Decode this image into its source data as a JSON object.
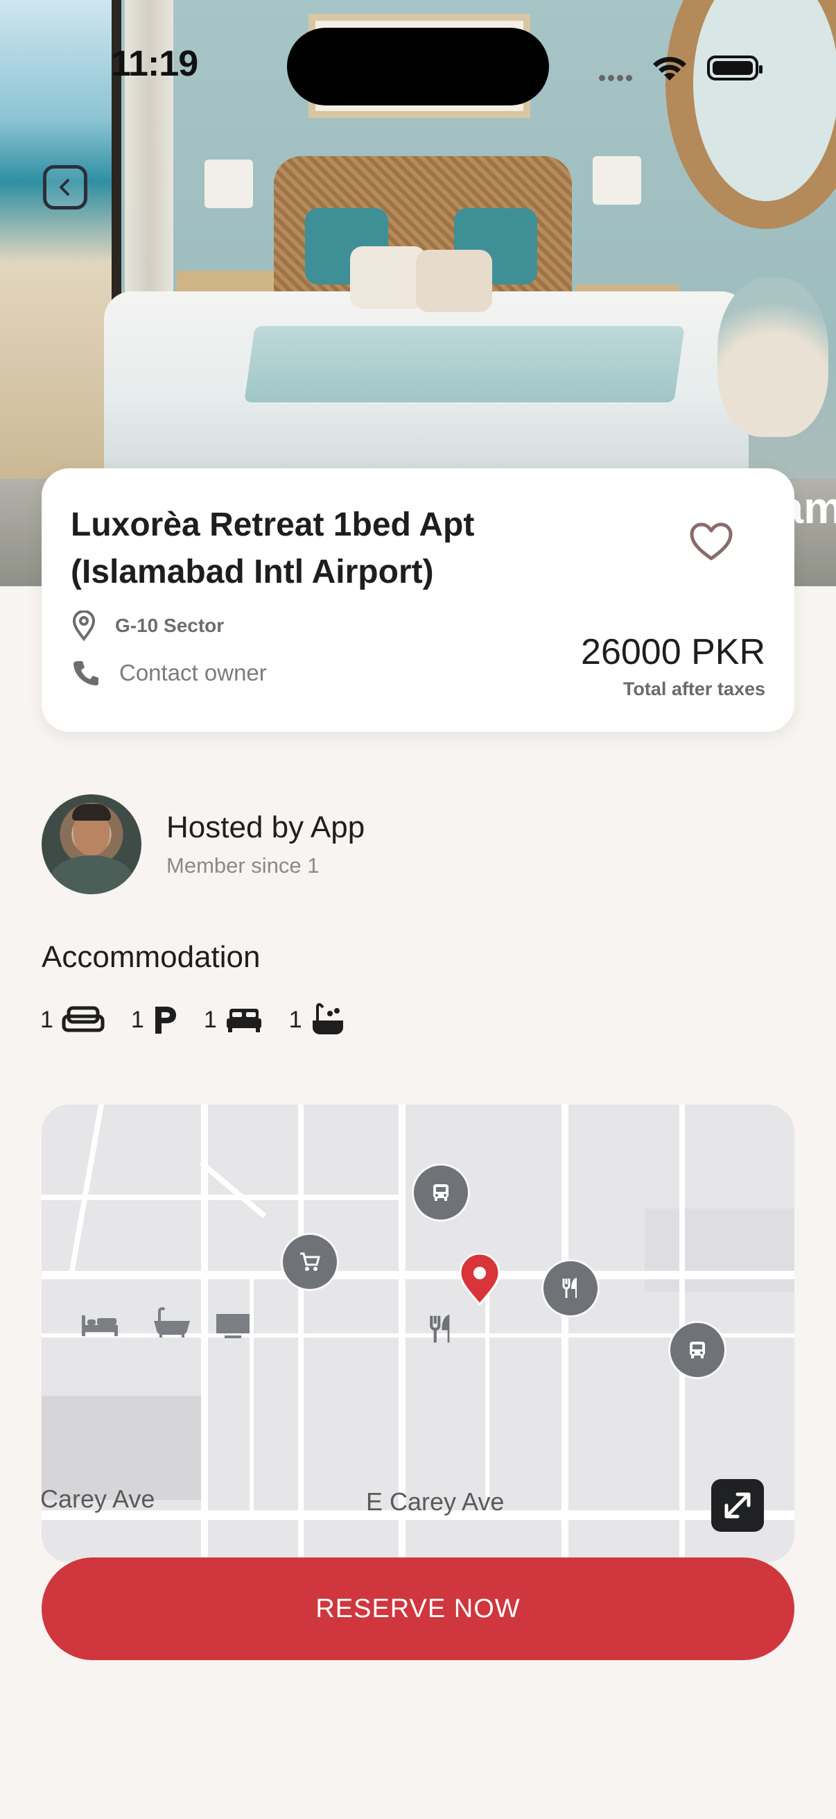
{
  "status_bar": {
    "time": "11:19"
  },
  "hero": {
    "overlay_text": "am"
  },
  "listing": {
    "title": "Luxorèa Retreat 1bed Apt (Islamabad Intl Airport)",
    "location": "G-10 Sector",
    "contact": "Contact owner",
    "price": "26000 PKR",
    "price_note": "Total after taxes"
  },
  "host": {
    "name": "Hosted by App",
    "member_since": "Member since 1"
  },
  "accommodation": {
    "title": "Accommodation",
    "items": [
      {
        "icon": "sofa-icon",
        "count": "1"
      },
      {
        "icon": "parking-icon",
        "count": "1"
      },
      {
        "icon": "bed-icon",
        "count": "1"
      },
      {
        "icon": "bathtub-icon",
        "count": "1"
      }
    ]
  },
  "map": {
    "streets": [
      "Carey Ave",
      "E Carey Ave"
    ],
    "poi_icons": [
      "bus-icon",
      "shopping-cart-icon",
      "location-pin-icon",
      "restaurant-icon",
      "bus-icon",
      "bed-icon",
      "bathtub-icon",
      "tv-icon",
      "restaurant-icon"
    ]
  },
  "cta": {
    "reserve_label": "RESERVE NOW"
  },
  "colors": {
    "accent": "#cf363d",
    "background": "#f8f4f1",
    "card": "#ffffff"
  }
}
